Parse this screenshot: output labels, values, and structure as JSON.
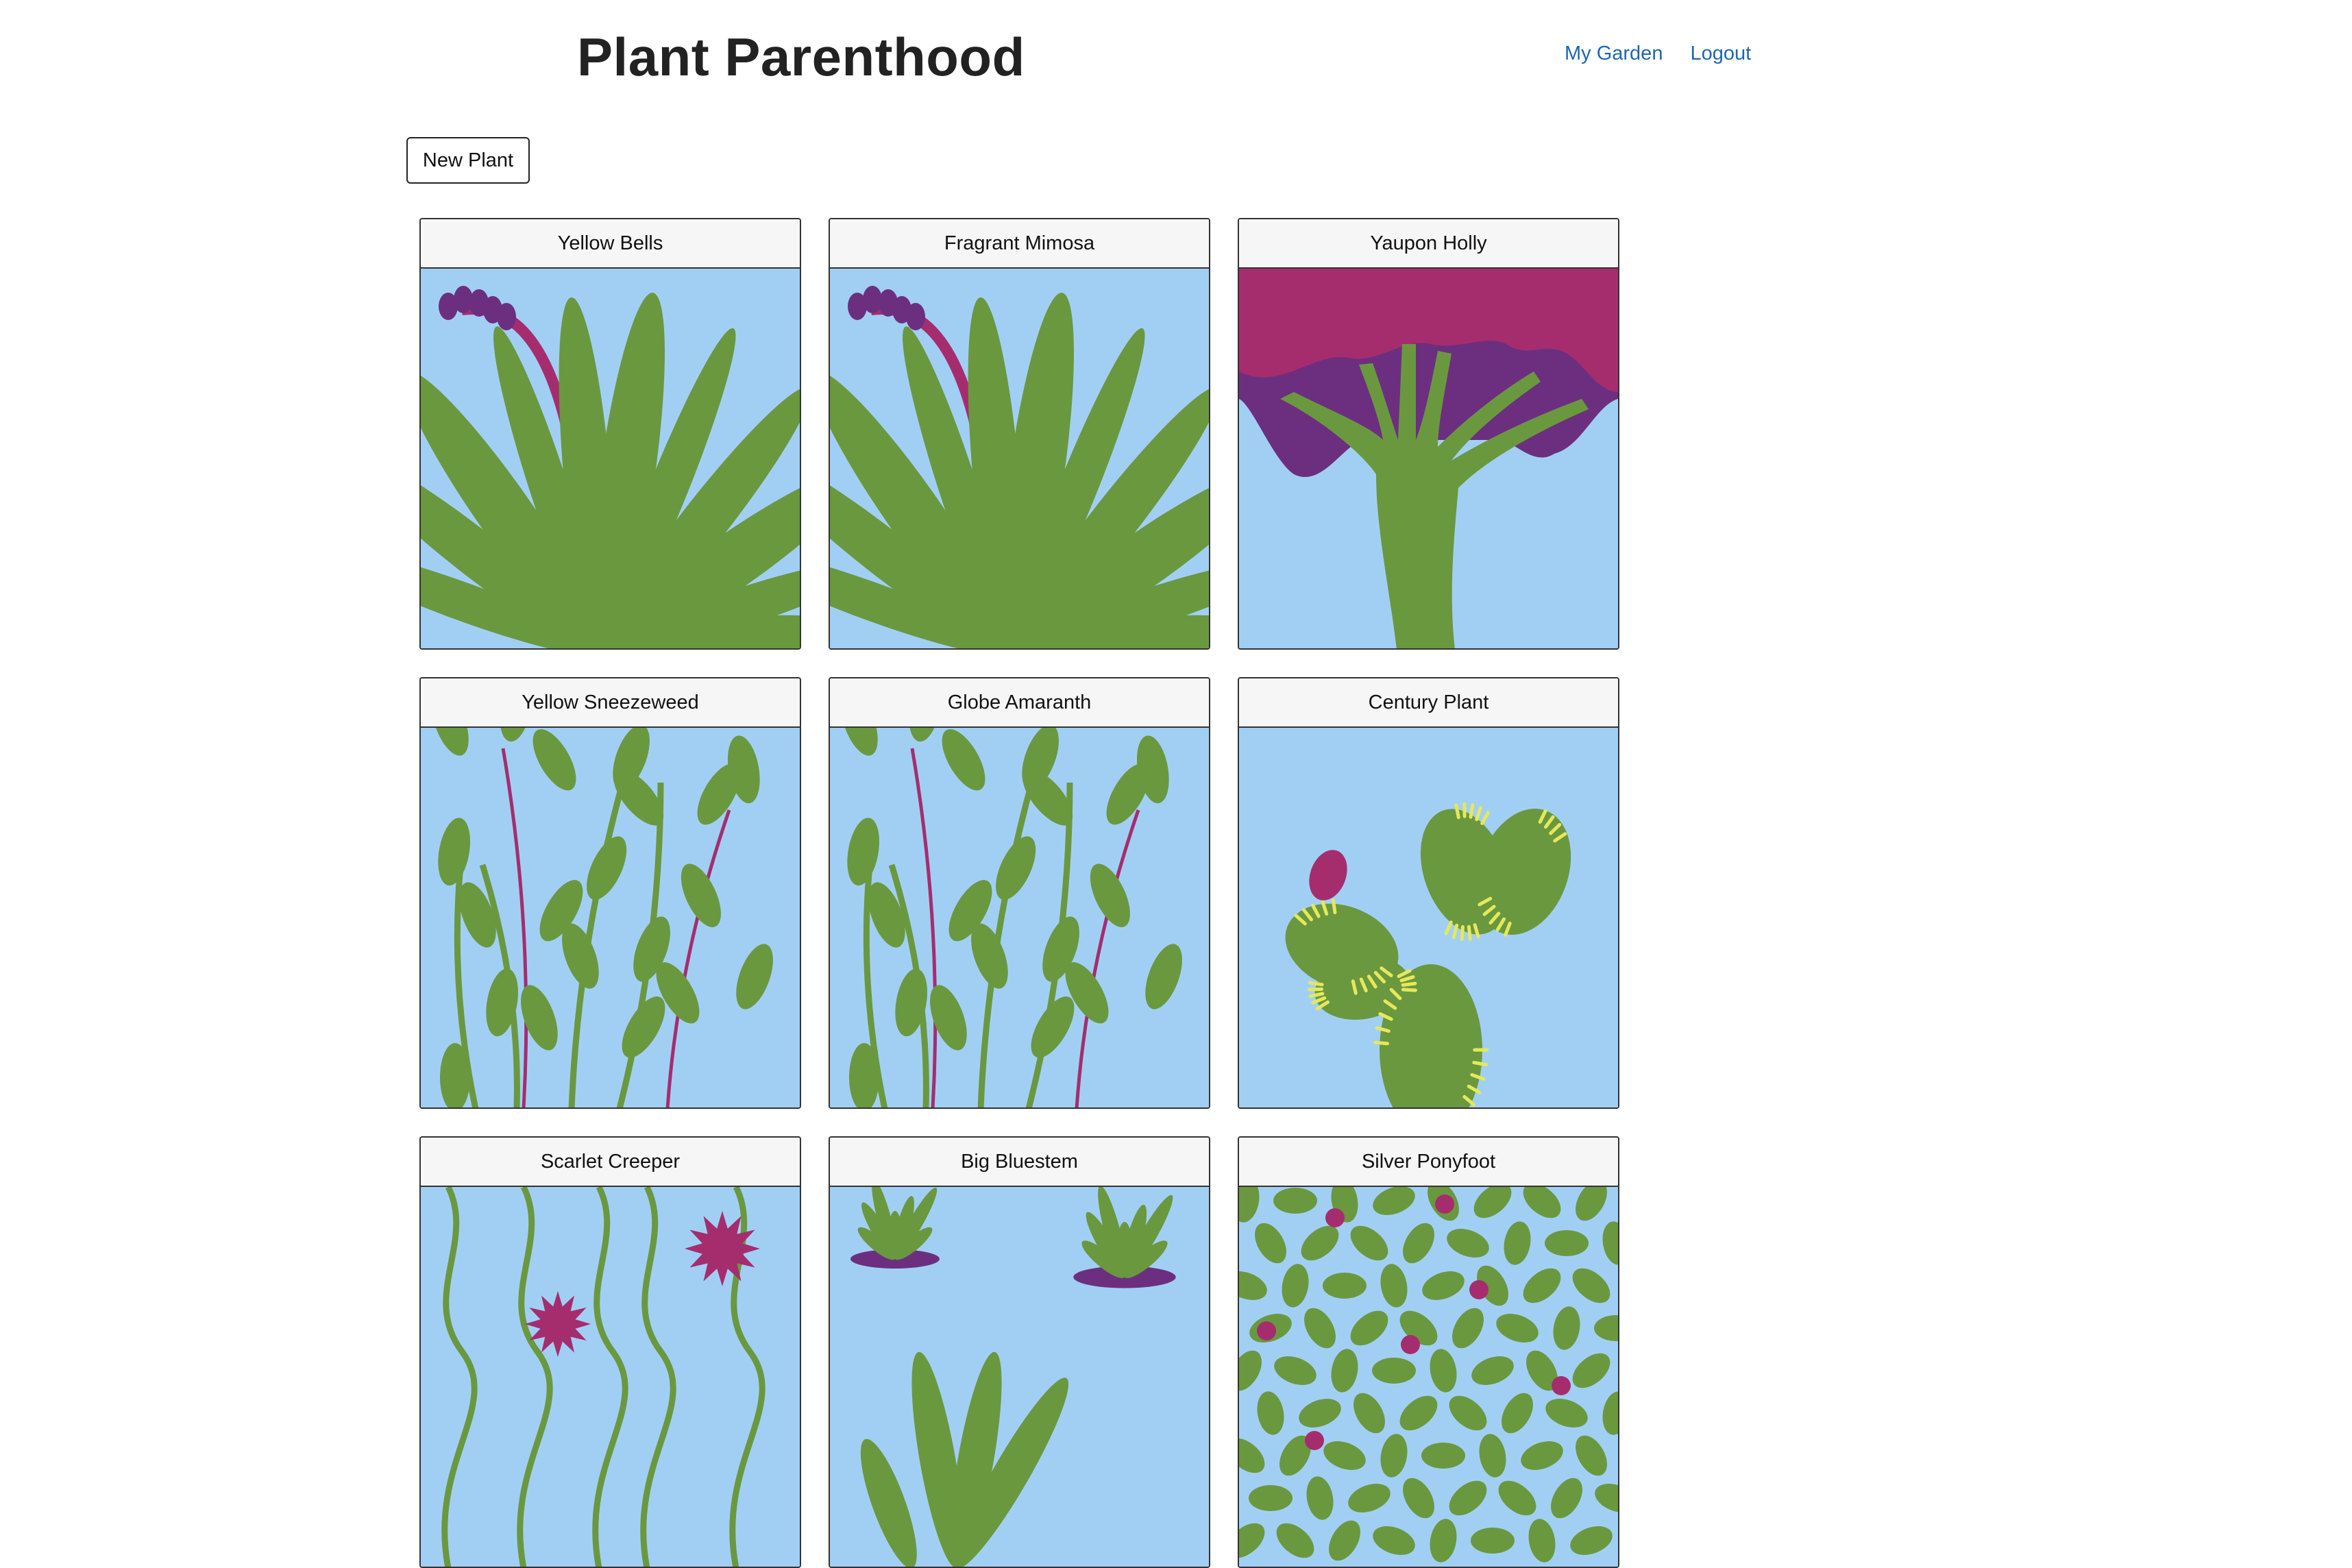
{
  "header": {
    "title": "Plant Parenthood",
    "nav": {
      "my_garden": "My Garden",
      "logout": "Logout"
    }
  },
  "toolbar": {
    "new_plant_label": "New Plant"
  },
  "plants": [
    {
      "name": "Yellow Bells",
      "art": "agave-bloom"
    },
    {
      "name": "Fragrant Mimosa",
      "art": "agave-bloom"
    },
    {
      "name": "Yaupon Holly",
      "art": "tree"
    },
    {
      "name": "Yellow Sneezeweed",
      "art": "leafy-stems"
    },
    {
      "name": "Globe Amaranth",
      "art": "leafy-stems"
    },
    {
      "name": "Century Plant",
      "art": "prickly-pear"
    },
    {
      "name": "Scarlet Creeper",
      "art": "vines"
    },
    {
      "name": "Big Bluestem",
      "art": "grass-tufts"
    },
    {
      "name": "Silver Ponyfoot",
      "art": "groundcover"
    }
  ],
  "colors": {
    "sky": "#a1cff4",
    "leaf": "#6a983f",
    "flower": "#a52d6e",
    "flower_dark": "#6c2f80",
    "spine": "#e6e85a",
    "link": "#1f66b0"
  }
}
